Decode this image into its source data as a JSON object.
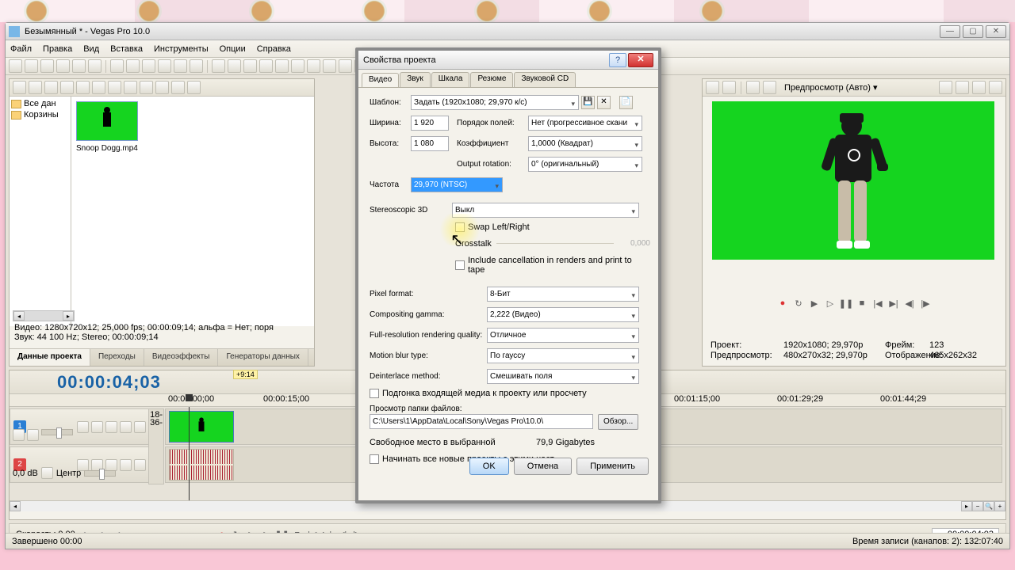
{
  "window": {
    "title": "Безымянный * - Vegas Pro 10.0"
  },
  "menu": [
    "Файл",
    "Правка",
    "Вид",
    "Вставка",
    "Инструменты",
    "Опции",
    "Справка"
  ],
  "media": {
    "tree": [
      "Все дан",
      "Корзины"
    ],
    "clip_name": "Snoop Dogg.mp4",
    "info_line1": "Видео: 1280x720x12; 25,000 fps; 00:00:09;14; альфа = Нет; поря",
    "info_line2": "Звук: 44 100 Hz; Stereo; 00:00:09;14",
    "tabs": [
      "Данные проекта",
      "Переходы",
      "Видеоэффекты",
      "Генераторы данных"
    ]
  },
  "preview": {
    "title": "Предпросмотр (Авто) ▾",
    "meta_project_lbl": "Проект:",
    "meta_project": "1920x1080; 29,970p",
    "meta_frame_lbl": "Фрейм:",
    "meta_frame": "123",
    "meta_prev_lbl": "Предпросмотр:",
    "meta_prev": "480x270x32; 29,970p",
    "meta_disp_lbl": "Отображение:",
    "meta_disp": "465x262x32"
  },
  "timeline": {
    "timecode": "00:00:04;03",
    "marker": "+9:14",
    "ruler": [
      "00:00:00;00",
      "00:00:15;00",
      "00:01:15;00",
      "00:01:29;29",
      "00:01:44;29"
    ],
    "track2_vol": "0,0 dB",
    "track2_pan": "Центр",
    "ruler_ticks": [
      "18-",
      "36-"
    ],
    "speed_lbl": "Скорость:",
    "speed": "0,00",
    "time_box": "00:00:04;03"
  },
  "statusbar": {
    "left": "Завершено 00:00",
    "right": "Время записи (канапов: 2): 132:07:40"
  },
  "dialog": {
    "title": "Свойства проекта",
    "tabs": [
      "Видео",
      "Звук",
      "Шкала",
      "Резюме",
      "Звуковой CD"
    ],
    "template_lbl": "Шаблон:",
    "template": "Задать (1920x1080; 29,970 к/с)",
    "width_lbl": "Ширина:",
    "width": "1 920",
    "height_lbl": "Высота:",
    "height": "1 080",
    "field_lbl": "Порядок полей:",
    "field": "Нет (прогрессивное скани",
    "aspect_lbl": "Коэффициент",
    "aspect": "1,0000 (Квадрат)",
    "rotation_lbl": "Output rotation:",
    "rotation": "0° (оригинальный)",
    "rate_lbl": "Частота",
    "rate": "29,970 (NTSC)",
    "stereo_lbl": "Stereoscopic 3D",
    "stereo": "Выкл",
    "swap": "Swap Left/Right",
    "crosstalk": "Crosstalk",
    "crosstalk_val": "0,000",
    "include": "Include cancellation in renders and print to tape",
    "pixel_lbl": "Pixel format:",
    "pixel": "8-Бит",
    "gamma_lbl": "Compositing gamma:",
    "gamma": "2,222 (Видео)",
    "quality_lbl": "Full-resolution rendering quality:",
    "quality": "Отличное",
    "blur_lbl": "Motion blur type:",
    "blur": "По гауссу",
    "deint_lbl": "Deinterlace method:",
    "deint": "Смешивать поля",
    "adjust": "Подгонка входящей медиа к проекту или просчету",
    "folder_lbl": "Просмотр папки файлов:",
    "folder": "C:\\Users\\1\\AppData\\Local\\Sony\\Vegas Pro\\10.0\\",
    "browse": "Обзор...",
    "freespace_lbl": "Свободное место в выбранной",
    "freespace": "79,9 Gigabytes",
    "start_new": "Начинать все новые проекты с этими наст",
    "ok": "OK",
    "cancel": "Отмена",
    "apply": "Применить"
  }
}
